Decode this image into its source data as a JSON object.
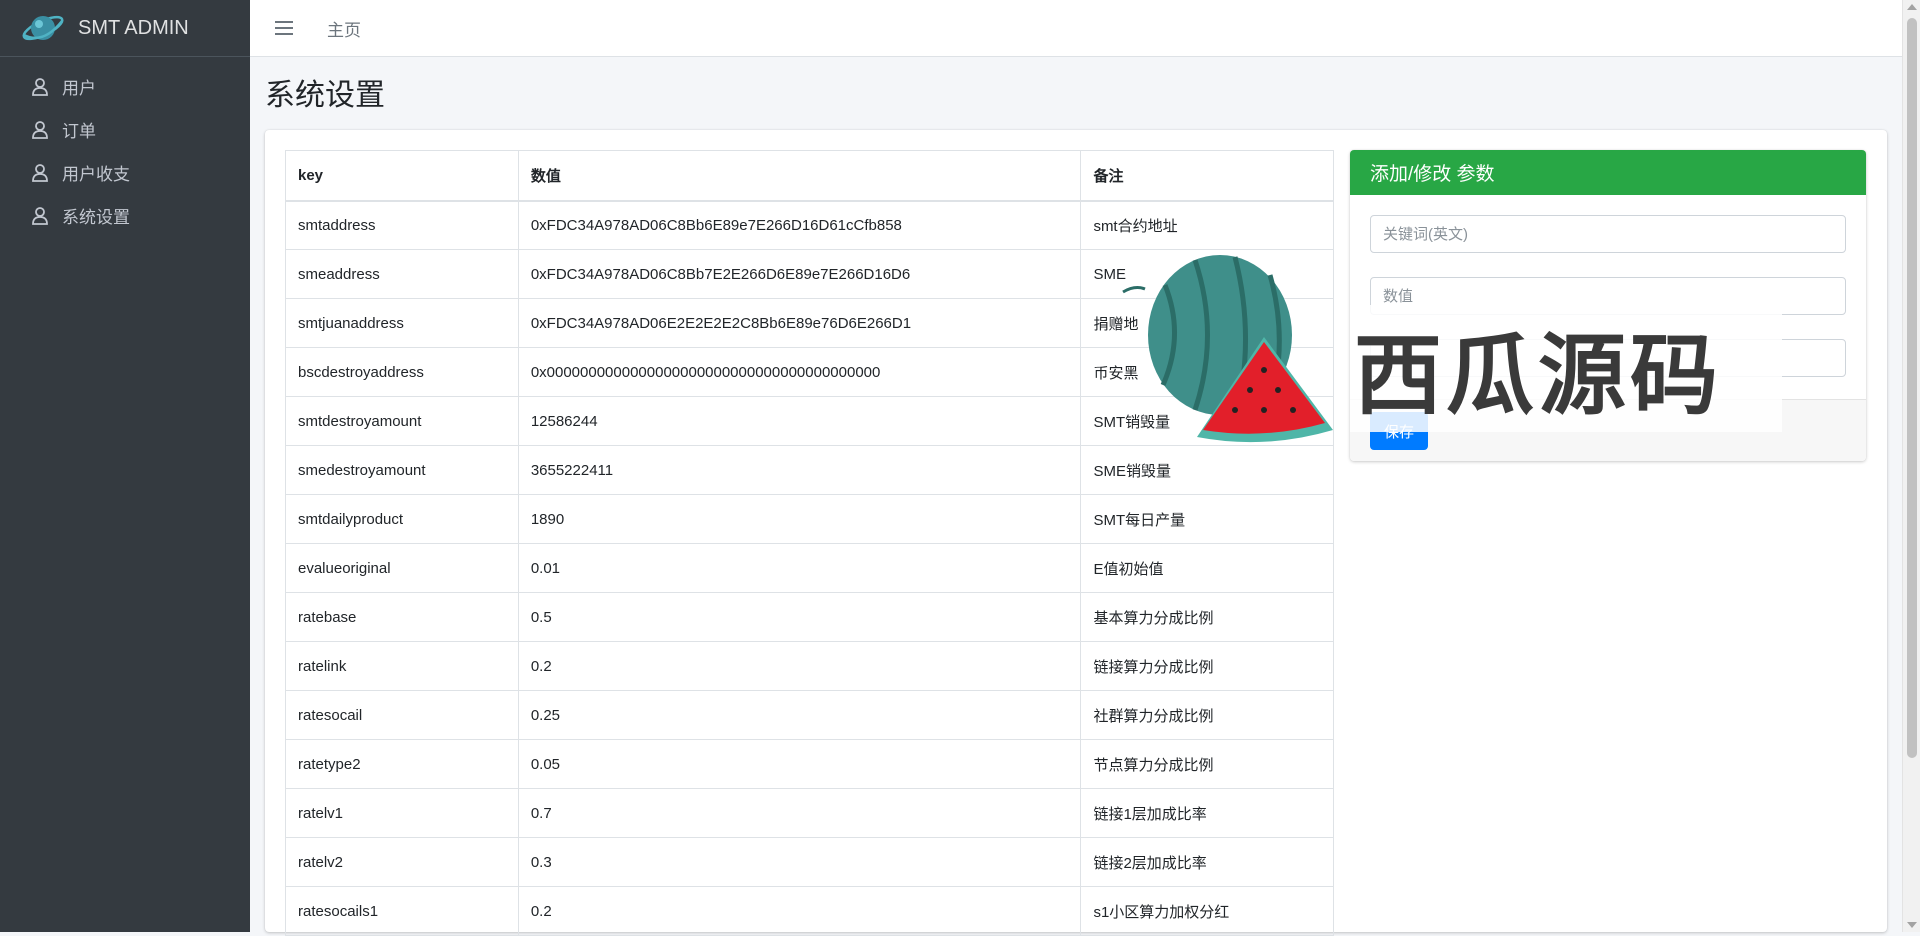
{
  "brand": {
    "name": "SMT ADMIN"
  },
  "sidebar": {
    "items": [
      {
        "label": "用户",
        "icon": "user-icon"
      },
      {
        "label": "订单",
        "icon": "user-icon"
      },
      {
        "label": "用户收支",
        "icon": "user-icon"
      },
      {
        "label": "系统设置",
        "icon": "user-icon"
      }
    ]
  },
  "navbar": {
    "menu_icon": "hamburger-icon",
    "home_link": "主页"
  },
  "page": {
    "title": "系统设置"
  },
  "table": {
    "headers": {
      "key": "key",
      "value": "数值",
      "note": "备注"
    },
    "rows": [
      {
        "key": "smtaddress",
        "value": "0xFDC34A978AD06C8Bb6E89e7E266D16D61cCfb858",
        "note": "smt合约地址"
      },
      {
        "key": "smeaddress",
        "value": "0xFDC34A978AD06C8Bb7E2E266D6E89e7E266D16D6",
        "note": "SME"
      },
      {
        "key": "smtjuanaddress",
        "value": "0xFDC34A978AD06E2E2E2E2C8Bb6E89e76D6E266D1",
        "note": "捐赠地"
      },
      {
        "key": "bscdestroyaddress",
        "value": "0x0000000000000000000000000000000000000000",
        "note": "币安黑"
      },
      {
        "key": "smtdestroyamount",
        "value": "12586244",
        "note": "SMT销毁量"
      },
      {
        "key": "smedestroyamount",
        "value": "3655222411",
        "note": "SME销毁量"
      },
      {
        "key": "smtdailyproduct",
        "value": "1890",
        "note": "SMT每日产量"
      },
      {
        "key": "evalueoriginal",
        "value": "0.01",
        "note": "E值初始值"
      },
      {
        "key": "ratebase",
        "value": "0.5",
        "note": "基本算力分成比例"
      },
      {
        "key": "ratelink",
        "value": "0.2",
        "note": "链接算力分成比例"
      },
      {
        "key": "ratesocail",
        "value": "0.25",
        "note": "社群算力分成比例"
      },
      {
        "key": "ratetype2",
        "value": "0.05",
        "note": "节点算力分成比例"
      },
      {
        "key": "ratelv1",
        "value": "0.7",
        "note": "链接1层加成比率"
      },
      {
        "key": "ratelv2",
        "value": "0.3",
        "note": "链接2层加成比率"
      },
      {
        "key": "ratesocails1",
        "value": "0.2",
        "note": "s1小区算力加权分红"
      }
    ]
  },
  "form": {
    "title": "添加/修改 参数",
    "key_placeholder": "关键词(英文)",
    "value_placeholder": "数值",
    "note_placeholder": "",
    "save_label": "保存"
  },
  "watermark": {
    "text": "西瓜源码"
  },
  "colors": {
    "sidebar_bg": "#343a40",
    "form_header": "#28a745",
    "primary": "#007bff"
  }
}
